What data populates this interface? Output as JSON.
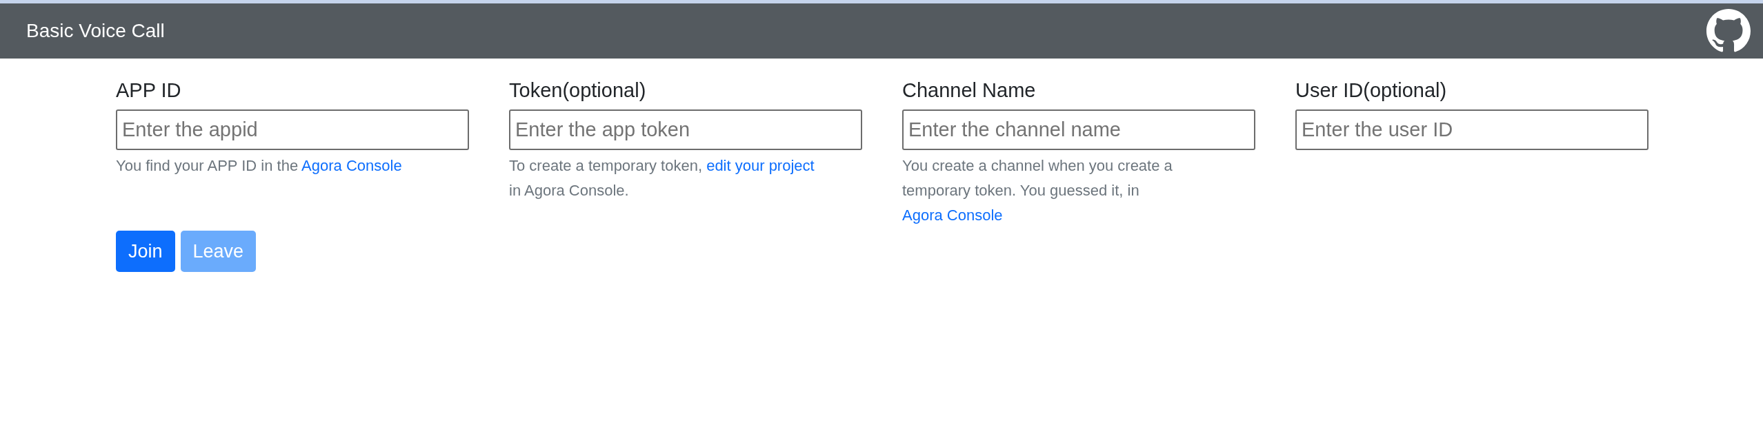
{
  "navbar": {
    "title": "Basic Voice Call"
  },
  "fields": [
    {
      "label": "APP ID",
      "placeholder": "Enter the appid",
      "help": [
        {
          "kind": "text",
          "text": "You find your APP ID in the "
        },
        {
          "kind": "link",
          "text": "Agora Console"
        }
      ]
    },
    {
      "label": "Token(optional)",
      "placeholder": "Enter the app token",
      "help": [
        {
          "kind": "text",
          "text": "To create a temporary token, "
        },
        {
          "kind": "link",
          "text": "edit your project"
        },
        {
          "kind": "text",
          "text": " in Agora Console."
        }
      ]
    },
    {
      "label": "Channel Name",
      "placeholder": "Enter the channel name",
      "help": [
        {
          "kind": "text",
          "text": "You create a channel when you create a temporary token. You guessed it, in "
        },
        {
          "kind": "link",
          "text": "Agora Console"
        }
      ]
    },
    {
      "label": "User ID(optional)",
      "placeholder": "Enter the user ID"
    }
  ],
  "buttons": [
    {
      "label": "Join",
      "disabled": false
    },
    {
      "label": "Leave",
      "disabled": true
    }
  ]
}
